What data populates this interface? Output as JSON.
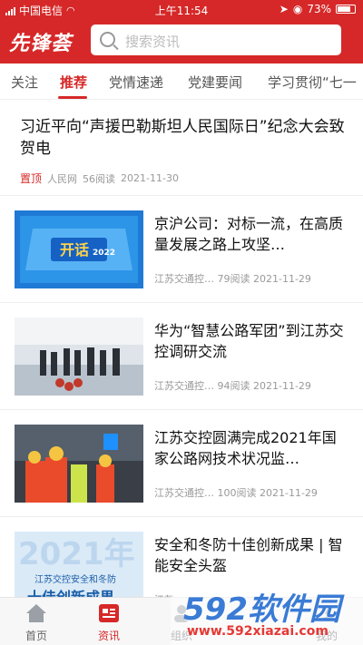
{
  "status_bar": {
    "carrier": "中国电信",
    "time": "上午11:54",
    "battery": "73%"
  },
  "header": {
    "logo": "先锋荟",
    "search_placeholder": "搜索资讯"
  },
  "tabs": [
    {
      "label": "关注"
    },
    {
      "label": "推荐"
    },
    {
      "label": "党情速递"
    },
    {
      "label": "党建要闻"
    },
    {
      "label": "学习贯彻“七一"
    }
  ],
  "feature": {
    "title": "习近平向“声援巴勒斯坦人民国际日”纪念大会致贺电",
    "pin": "置顶",
    "source": "人民网",
    "reads": "56阅读",
    "date": "2021-11-30"
  },
  "articles": [
    {
      "title": "京沪公司：对标一流，在高质量发展之路上攻坚…",
      "source": "江苏交通控…",
      "reads": "79阅读",
      "date": "2021-11-29",
      "thumb_text": "2022",
      "thumb_text2": "开话"
    },
    {
      "title": "华为“智慧公路军团”到江苏交控调研交流",
      "source": "江苏交通控…",
      "reads": "94阅读",
      "date": "2021-11-29"
    },
    {
      "title": "江苏交控圆满完成2021年国家公路网技术状况监…",
      "source": "江苏交通控…",
      "reads": "100阅读",
      "date": "2021-11-29"
    },
    {
      "title": "安全和冬防十佳创新成果 | 智能安全头盔",
      "source": "江苏",
      "reads": "",
      "date": "",
      "thumb_text": "2021年",
      "thumb_text2": "江苏交控安全和冬防",
      "thumb_text3": "十佳创新成果"
    }
  ],
  "bottom_nav": [
    {
      "label": "首页"
    },
    {
      "label": "资讯"
    },
    {
      "label": "组织"
    },
    {
      "label": ""
    },
    {
      "label": "我的"
    }
  ],
  "watermark": {
    "big": "592软件园",
    "small": "www.592xiazai.com"
  }
}
